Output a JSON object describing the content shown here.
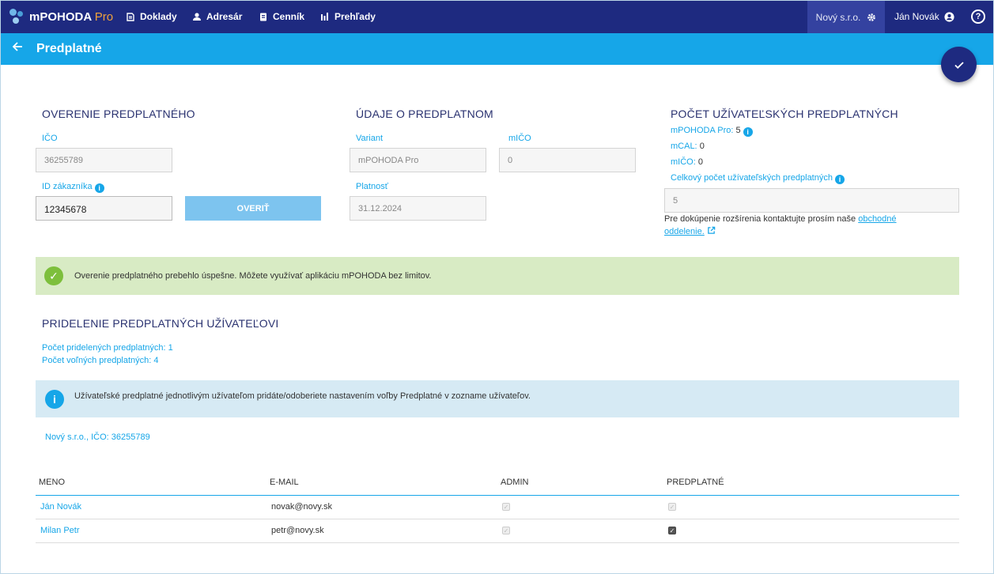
{
  "app": {
    "name": "mPOHODA",
    "edition": "Pro"
  },
  "nav": [
    {
      "label": "Doklady",
      "icon": "documents-icon"
    },
    {
      "label": "Adresár",
      "icon": "person-icon"
    },
    {
      "label": "Cenník",
      "icon": "clipboard-icon"
    },
    {
      "label": "Prehľady",
      "icon": "bar-chart-icon"
    }
  ],
  "company": "Nový s.r.o.",
  "user": "Ján Novák",
  "page": {
    "title": "Predplatné"
  },
  "verify": {
    "title": "OVERENIE PREDPLATNÉHO",
    "ico_label": "IČO",
    "ico_value": "36255789",
    "customer_label": "ID zákazníka",
    "customer_value": "12345678",
    "button": "OVERIŤ"
  },
  "subscription": {
    "title": "ÚDAJE O PREDPLATNOM",
    "variant_label": "Variant",
    "variant_value": "mPOHODA Pro",
    "mico_label": "mIČO",
    "mico_value": "0",
    "validity_label": "Platnosť",
    "validity_value": "31.12.2024"
  },
  "counts": {
    "title": "POČET UŽÍVATEĽSKÝCH PREDPLATNÝCH",
    "pro_label": "mPOHODA Pro:",
    "pro_value": "5",
    "mcal_label": "mCAL:",
    "mcal_value": "0",
    "mico_label": "mIČO:",
    "mico_value": "0",
    "total_label": "Celkový počet užívateľských predplatných",
    "total_value": "5",
    "contact_text": "Pre dokúpenie rozšírenia kontaktujte prosím naše",
    "contact_link": "obchodné oddelenie."
  },
  "success_message": "Overenie predplatného prebehlo úspešne. Môžete využívať aplikáciu mPOHODA bez limitov.",
  "assign": {
    "title": "PRIDELENIE PREDPLATNÝCH UŽÍVATEĽOVI",
    "assigned": "Počet pridelených predplatných: 1",
    "free": "Počet voľných predplatných: 4",
    "info": "Užívateľské predplatné jednotlivým užívateľom pridáte/odoberiete nastavením voľby Predplatné v zozname užívateľov.",
    "company_line": "Nový s.r.o., IČO: 36255789"
  },
  "table": {
    "headers": [
      "MENO",
      "E-MAIL",
      "ADMIN",
      "PREDPLATNÉ"
    ],
    "rows": [
      {
        "name": "Ján Novák",
        "email": "novak@novy.sk",
        "admin": true,
        "subscription": true,
        "admin_disabled": true,
        "subscription_disabled": true
      },
      {
        "name": "Milan Petr",
        "email": "petr@novy.sk",
        "admin": true,
        "subscription": true,
        "admin_disabled": true,
        "subscription_disabled": false
      }
    ]
  },
  "colors": {
    "topbar": "#1e2a80",
    "accent": "#16a6e8",
    "success_bg": "#d8ebc4",
    "info_bg": "#d6eaf4"
  }
}
